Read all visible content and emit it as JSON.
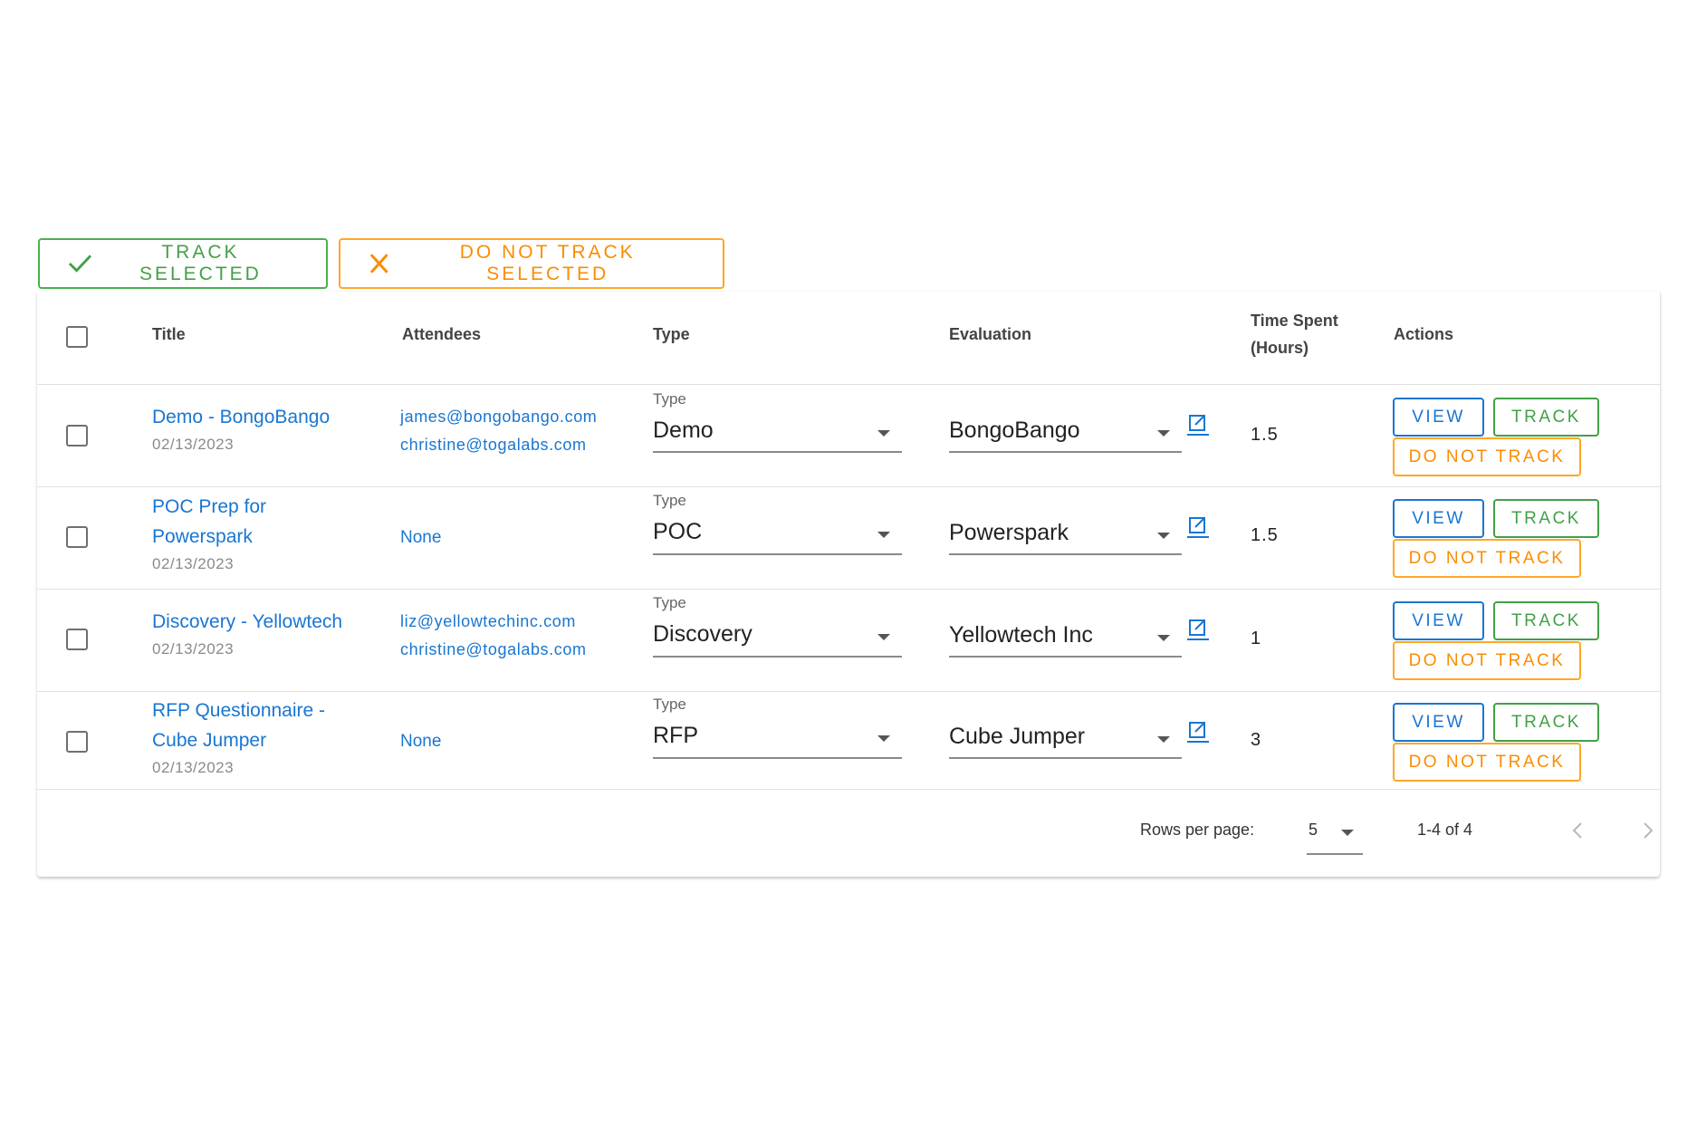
{
  "toolbar": {
    "track_selected_label": "TRACK SELECTED",
    "do_not_track_selected_label": "DO NOT TRACK SELECTED"
  },
  "table": {
    "headers": {
      "title": "Title",
      "attendees": "Attendees",
      "type": "Type",
      "evaluation": "Evaluation",
      "time_spent_line1": "Time Spent",
      "time_spent_line2": "(Hours)",
      "actions": "Actions"
    },
    "rows": [
      {
        "title_line1": "Demo - BongoBango",
        "title_line2": "",
        "date": "02/13/2023",
        "attendee1": "james@bongobango.com",
        "attendee2": "christine@togalabs.com",
        "attendees_none": "",
        "type_label": "Type",
        "type_value": "Demo",
        "evaluation": "BongoBango",
        "time": "1.5"
      },
      {
        "title_line1": "POC Prep for",
        "title_line2": "Powerspark",
        "date": "02/13/2023",
        "attendee1": "",
        "attendee2": "",
        "attendees_none": "None",
        "type_label": "Type",
        "type_value": "POC",
        "evaluation": "Powerspark",
        "time": "1.5"
      },
      {
        "title_line1": "Discovery - Yellowtech",
        "title_line2": "",
        "date": "02/13/2023",
        "attendee1": "liz@yellowtechinc.com",
        "attendee2": "christine@togalabs.com",
        "attendees_none": "",
        "type_label": "Type",
        "type_value": "Discovery",
        "evaluation": "Yellowtech Inc",
        "time": "1"
      },
      {
        "title_line1": "RFP Questionnaire -",
        "title_line2": "Cube Jumper",
        "date": "02/13/2023",
        "attendee1": "",
        "attendee2": "",
        "attendees_none": "None",
        "type_label": "Type",
        "type_value": "RFP",
        "evaluation": "Cube Jumper",
        "time": "3"
      }
    ],
    "actions": {
      "view_label": "VIEW",
      "track_label": "TRACK",
      "do_not_track_label": "DO NOT TRACK"
    }
  },
  "pagination": {
    "rows_per_page_label": "Rows per page:",
    "rows_per_page_value": "5",
    "range_text": "1-4 of 4"
  },
  "colors": {
    "link_blue": "#1976d2",
    "track_green": "#43a047",
    "do_not_track_orange": "#fb8c00"
  },
  "icons": {
    "bulk_track": "check-icon",
    "bulk_do_not_track": "close-icon",
    "evaluation_link": "open-in-new-icon",
    "select_dropdown": "caret-down-icon",
    "prev_page": "chevron-left-icon",
    "next_page": "chevron-right-icon"
  }
}
